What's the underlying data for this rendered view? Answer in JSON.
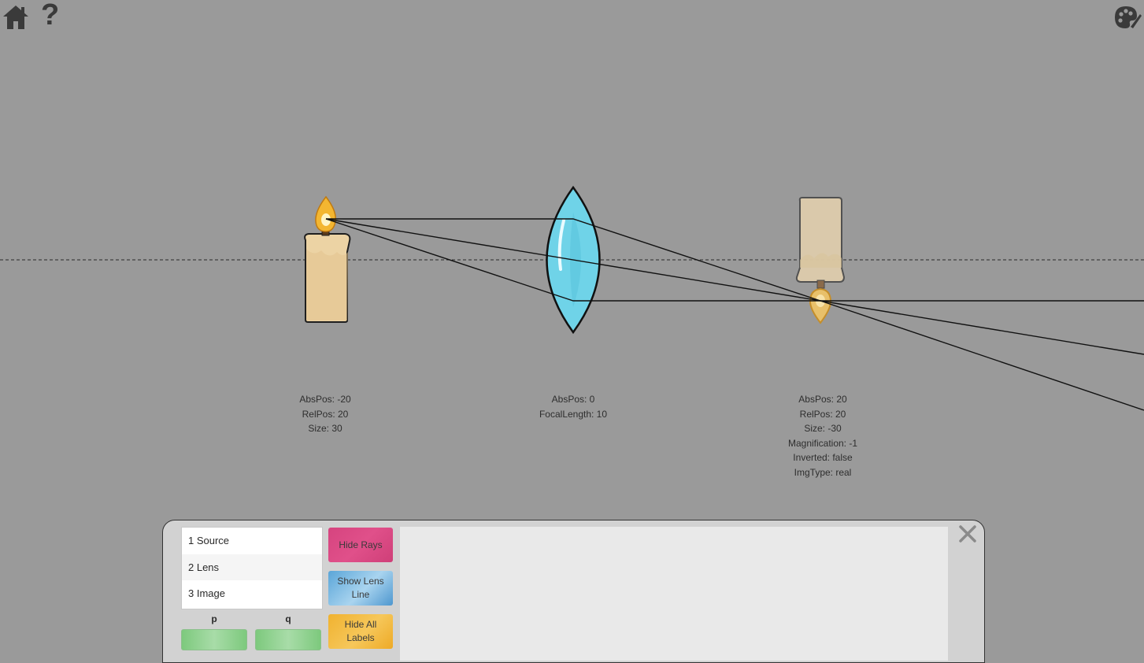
{
  "toolbar": {
    "home_icon": "home-icon",
    "help_label": "?",
    "palette_icon": "palette-icon"
  },
  "scene": {
    "source_labels": [
      "AbsPos: -20",
      "RelPos: 20",
      "Size: 30"
    ],
    "lens_labels": [
      "AbsPos: 0",
      "FocalLength: 10"
    ],
    "image_labels": [
      "AbsPos: 20",
      "RelPos: 20",
      "Size: -30",
      "Magnification: -1",
      "Inverted: false",
      "ImgType: real"
    ]
  },
  "panel": {
    "objects": [
      "1 Source",
      "2 Lens",
      "3 Image"
    ],
    "p_label": "p",
    "q_label": "q",
    "p_value": "",
    "q_value": "",
    "hide_rays": "Hide Rays",
    "show_lens_line": "Show Lens Line",
    "hide_all_labels": "Hide All Labels",
    "console_text": ""
  },
  "colors": {
    "background": "#9a9a9a",
    "lens_fill": "#6fd3e8",
    "candle_body": "#ecd3a4",
    "flame": "#f3b631",
    "hide_rays_btn": "#d6447f",
    "lens_line_btn": "#5aa5d8",
    "labels_btn": "#f0b230"
  }
}
